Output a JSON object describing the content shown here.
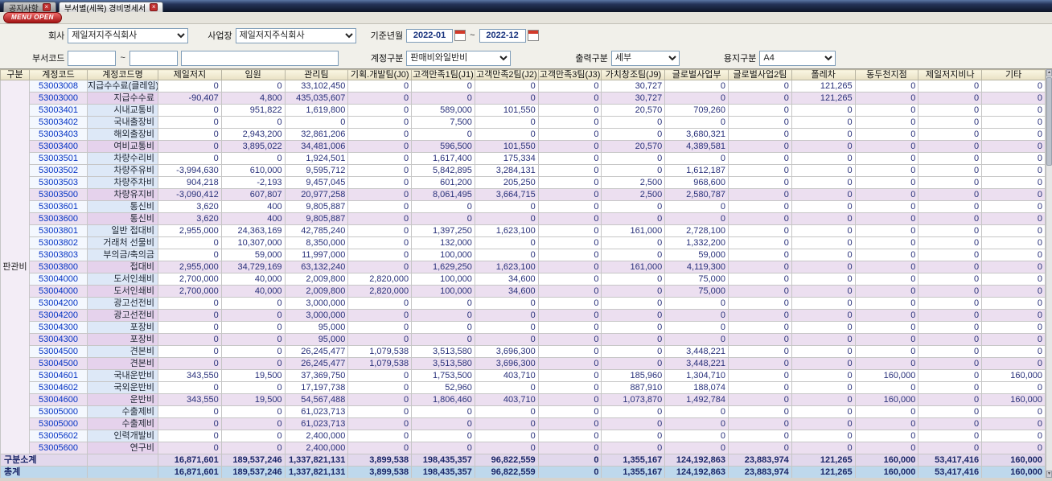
{
  "tabs": [
    {
      "label": "공지사항"
    },
    {
      "label": "부서별(세목) 경비명세서"
    }
  ],
  "menu_button": "MENU OPEN",
  "filters": {
    "company": {
      "label": "회사",
      "value": "제일저지주식회사"
    },
    "site": {
      "label": "사업장",
      "value": "제일저지주식회사"
    },
    "period": {
      "label": "기준년월",
      "from": "2022-01",
      "to": "2022-12",
      "separator": "~"
    },
    "dept_code": {
      "label": "부서코드",
      "from": "",
      "to": "",
      "separator": "~"
    },
    "account_type": {
      "label": "계정구분",
      "value": "판매비와일반비"
    },
    "output_type": {
      "label": "출력구분",
      "value": "세부"
    },
    "paper_type": {
      "label": "용지구분",
      "value": "A4"
    }
  },
  "colors": {
    "tab_close_red": "#c03030",
    "menu_button_red": "#a51414",
    "header_cream": "#efe8cd",
    "subtotal_pink": "#ecdff0",
    "grand_total_blue": "#bed8ec",
    "code_blue": "#0433c4",
    "value_navy": "#28307a"
  },
  "table": {
    "group_label": "판관비",
    "headers": [
      "구분",
      "계정코드",
      "계정코드명",
      "제일저지",
      "임원",
      "관리팀",
      "기획.개발팀(J0)",
      "고객만족1팀(J1)",
      "고객만족2팀(J2)",
      "고객만족3팀(J3)",
      "가치창조팀(J9)",
      "글로벌사업부",
      "글로벌사업2팀",
      "폴레차",
      "동두천지점",
      "제일저지비나",
      "기타"
    ],
    "rows": [
      {
        "code": "53003008",
        "name": "지급수수료(클레임)",
        "subtotal": false,
        "values": [
          "0",
          "0",
          "33,102,450",
          "0",
          "0",
          "0",
          "0",
          "30,727",
          "0",
          "0",
          "121,265",
          "0",
          "0",
          "0"
        ]
      },
      {
        "code": "53003000",
        "name": "지급수수료",
        "subtotal": true,
        "values": [
          "-90,407",
          "4,800",
          "435,035,607",
          "0",
          "0",
          "0",
          "0",
          "30,727",
          "0",
          "0",
          "121,265",
          "0",
          "0",
          "0"
        ]
      },
      {
        "code": "53003401",
        "name": "시내교통비",
        "subtotal": false,
        "values": [
          "0",
          "951,822",
          "1,619,800",
          "0",
          "589,000",
          "101,550",
          "0",
          "20,570",
          "709,260",
          "0",
          "0",
          "0",
          "0",
          "0"
        ]
      },
      {
        "code": "53003402",
        "name": "국내출장비",
        "subtotal": false,
        "values": [
          "0",
          "0",
          "0",
          "0",
          "7,500",
          "0",
          "0",
          "0",
          "0",
          "0",
          "0",
          "0",
          "0",
          "0"
        ]
      },
      {
        "code": "53003403",
        "name": "해외출장비",
        "subtotal": false,
        "values": [
          "0",
          "2,943,200",
          "32,861,206",
          "0",
          "0",
          "0",
          "0",
          "0",
          "3,680,321",
          "0",
          "0",
          "0",
          "0",
          "0"
        ]
      },
      {
        "code": "53003400",
        "name": "여비교통비",
        "subtotal": true,
        "values": [
          "0",
          "3,895,022",
          "34,481,006",
          "0",
          "596,500",
          "101,550",
          "0",
          "20,570",
          "4,389,581",
          "0",
          "0",
          "0",
          "0",
          "0"
        ]
      },
      {
        "code": "53003501",
        "name": "차량수리비",
        "subtotal": false,
        "values": [
          "0",
          "0",
          "1,924,501",
          "0",
          "1,617,400",
          "175,334",
          "0",
          "0",
          "0",
          "0",
          "0",
          "0",
          "0",
          "0"
        ]
      },
      {
        "code": "53003502",
        "name": "차량주유비",
        "subtotal": false,
        "values": [
          "-3,994,630",
          "610,000",
          "9,595,712",
          "0",
          "5,842,895",
          "3,284,131",
          "0",
          "0",
          "1,612,187",
          "0",
          "0",
          "0",
          "0",
          "0"
        ]
      },
      {
        "code": "53003503",
        "name": "차량주차비",
        "subtotal": false,
        "values": [
          "904,218",
          "-2,193",
          "9,457,045",
          "0",
          "601,200",
          "205,250",
          "0",
          "2,500",
          "968,600",
          "0",
          "0",
          "0",
          "0",
          "0"
        ]
      },
      {
        "code": "53003500",
        "name": "차량유지비",
        "subtotal": true,
        "values": [
          "-3,090,412",
          "607,807",
          "20,977,258",
          "0",
          "8,061,495",
          "3,664,715",
          "0",
          "2,500",
          "2,580,787",
          "0",
          "0",
          "0",
          "0",
          "0"
        ]
      },
      {
        "code": "53003601",
        "name": "통신비",
        "subtotal": false,
        "values": [
          "3,620",
          "400",
          "9,805,887",
          "0",
          "0",
          "0",
          "0",
          "0",
          "0",
          "0",
          "0",
          "0",
          "0",
          "0"
        ]
      },
      {
        "code": "53003600",
        "name": "통신비",
        "subtotal": true,
        "values": [
          "3,620",
          "400",
          "9,805,887",
          "0",
          "0",
          "0",
          "0",
          "0",
          "0",
          "0",
          "0",
          "0",
          "0",
          "0"
        ]
      },
      {
        "code": "53003801",
        "name": "일반 접대비",
        "subtotal": false,
        "values": [
          "2,955,000",
          "24,363,169",
          "42,785,240",
          "0",
          "1,397,250",
          "1,623,100",
          "0",
          "161,000",
          "2,728,100",
          "0",
          "0",
          "0",
          "0",
          "0"
        ]
      },
      {
        "code": "53003802",
        "name": "거래처 선물비",
        "subtotal": false,
        "values": [
          "0",
          "10,307,000",
          "8,350,000",
          "0",
          "132,000",
          "0",
          "0",
          "0",
          "1,332,200",
          "0",
          "0",
          "0",
          "0",
          "0"
        ]
      },
      {
        "code": "53003803",
        "name": "부의금/축의금",
        "subtotal": false,
        "values": [
          "0",
          "59,000",
          "11,997,000",
          "0",
          "100,000",
          "0",
          "0",
          "0",
          "59,000",
          "0",
          "0",
          "0",
          "0",
          "0"
        ]
      },
      {
        "code": "53003800",
        "name": "접대비",
        "subtotal": true,
        "values": [
          "2,955,000",
          "34,729,169",
          "63,132,240",
          "0",
          "1,629,250",
          "1,623,100",
          "0",
          "161,000",
          "4,119,300",
          "0",
          "0",
          "0",
          "0",
          "0"
        ]
      },
      {
        "code": "53004000",
        "name": "도서인쇄비",
        "subtotal": false,
        "values": [
          "2,700,000",
          "40,000",
          "2,009,800",
          "2,820,000",
          "100,000",
          "34,600",
          "0",
          "0",
          "75,000",
          "0",
          "0",
          "0",
          "0",
          "0"
        ]
      },
      {
        "code": "53004000",
        "name": "도서인쇄비",
        "subtotal": true,
        "values": [
          "2,700,000",
          "40,000",
          "2,009,800",
          "2,820,000",
          "100,000",
          "34,600",
          "0",
          "0",
          "75,000",
          "0",
          "0",
          "0",
          "0",
          "0"
        ]
      },
      {
        "code": "53004200",
        "name": "광고선전비",
        "subtotal": false,
        "values": [
          "0",
          "0",
          "3,000,000",
          "0",
          "0",
          "0",
          "0",
          "0",
          "0",
          "0",
          "0",
          "0",
          "0",
          "0"
        ]
      },
      {
        "code": "53004200",
        "name": "광고선전비",
        "subtotal": true,
        "values": [
          "0",
          "0",
          "3,000,000",
          "0",
          "0",
          "0",
          "0",
          "0",
          "0",
          "0",
          "0",
          "0",
          "0",
          "0"
        ]
      },
      {
        "code": "53004300",
        "name": "포장비",
        "subtotal": false,
        "values": [
          "0",
          "0",
          "95,000",
          "0",
          "0",
          "0",
          "0",
          "0",
          "0",
          "0",
          "0",
          "0",
          "0",
          "0"
        ]
      },
      {
        "code": "53004300",
        "name": "포장비",
        "subtotal": true,
        "values": [
          "0",
          "0",
          "95,000",
          "0",
          "0",
          "0",
          "0",
          "0",
          "0",
          "0",
          "0",
          "0",
          "0",
          "0"
        ]
      },
      {
        "code": "53004500",
        "name": "견본비",
        "subtotal": false,
        "values": [
          "0",
          "0",
          "26,245,477",
          "1,079,538",
          "3,513,580",
          "3,696,300",
          "0",
          "0",
          "3,448,221",
          "0",
          "0",
          "0",
          "0",
          "0"
        ]
      },
      {
        "code": "53004500",
        "name": "견본비",
        "subtotal": true,
        "values": [
          "0",
          "0",
          "26,245,477",
          "1,079,538",
          "3,513,580",
          "3,696,300",
          "0",
          "0",
          "3,448,221",
          "0",
          "0",
          "0",
          "0",
          "0"
        ]
      },
      {
        "code": "53004601",
        "name": "국내운반비",
        "subtotal": false,
        "values": [
          "343,550",
          "19,500",
          "37,369,750",
          "0",
          "1,753,500",
          "403,710",
          "0",
          "185,960",
          "1,304,710",
          "0",
          "0",
          "160,000",
          "0",
          "160,000"
        ]
      },
      {
        "code": "53004602",
        "name": "국외운반비",
        "subtotal": false,
        "values": [
          "0",
          "0",
          "17,197,738",
          "0",
          "52,960",
          "0",
          "0",
          "887,910",
          "188,074",
          "0",
          "0",
          "0",
          "0",
          "0"
        ]
      },
      {
        "code": "53004600",
        "name": "운반비",
        "subtotal": true,
        "values": [
          "343,550",
          "19,500",
          "54,567,488",
          "0",
          "1,806,460",
          "403,710",
          "0",
          "1,073,870",
          "1,492,784",
          "0",
          "0",
          "160,000",
          "0",
          "160,000"
        ]
      },
      {
        "code": "53005000",
        "name": "수출제비",
        "subtotal": false,
        "values": [
          "0",
          "0",
          "61,023,713",
          "0",
          "0",
          "0",
          "0",
          "0",
          "0",
          "0",
          "0",
          "0",
          "0",
          "0"
        ]
      },
      {
        "code": "53005000",
        "name": "수출제비",
        "subtotal": true,
        "values": [
          "0",
          "0",
          "61,023,713",
          "0",
          "0",
          "0",
          "0",
          "0",
          "0",
          "0",
          "0",
          "0",
          "0",
          "0"
        ]
      },
      {
        "code": "53005602",
        "name": "인력개발비",
        "subtotal": false,
        "values": [
          "0",
          "0",
          "2,400,000",
          "0",
          "0",
          "0",
          "0",
          "0",
          "0",
          "0",
          "0",
          "0",
          "0",
          "0"
        ]
      },
      {
        "code": "53005600",
        "name": "연구비",
        "subtotal": true,
        "values": [
          "0",
          "0",
          "2,400,000",
          "0",
          "0",
          "0",
          "0",
          "0",
          "0",
          "0",
          "0",
          "0",
          "0",
          "0"
        ]
      }
    ],
    "footer": [
      {
        "label": "구분소계",
        "values": [
          "16,871,601",
          "189,537,246",
          "1,337,821,131",
          "3,899,538",
          "198,435,357",
          "96,822,559",
          "0",
          "1,355,167",
          "124,192,863",
          "23,883,974",
          "121,265",
          "160,000",
          "53,417,416",
          "160,000"
        ]
      },
      {
        "label": "총계",
        "values": [
          "16,871,601",
          "189,537,246",
          "1,337,821,131",
          "3,899,538",
          "198,435,357",
          "96,822,559",
          "0",
          "1,355,167",
          "124,192,863",
          "23,883,974",
          "121,265",
          "160,000",
          "53,417,416",
          "160,000"
        ]
      }
    ]
  }
}
